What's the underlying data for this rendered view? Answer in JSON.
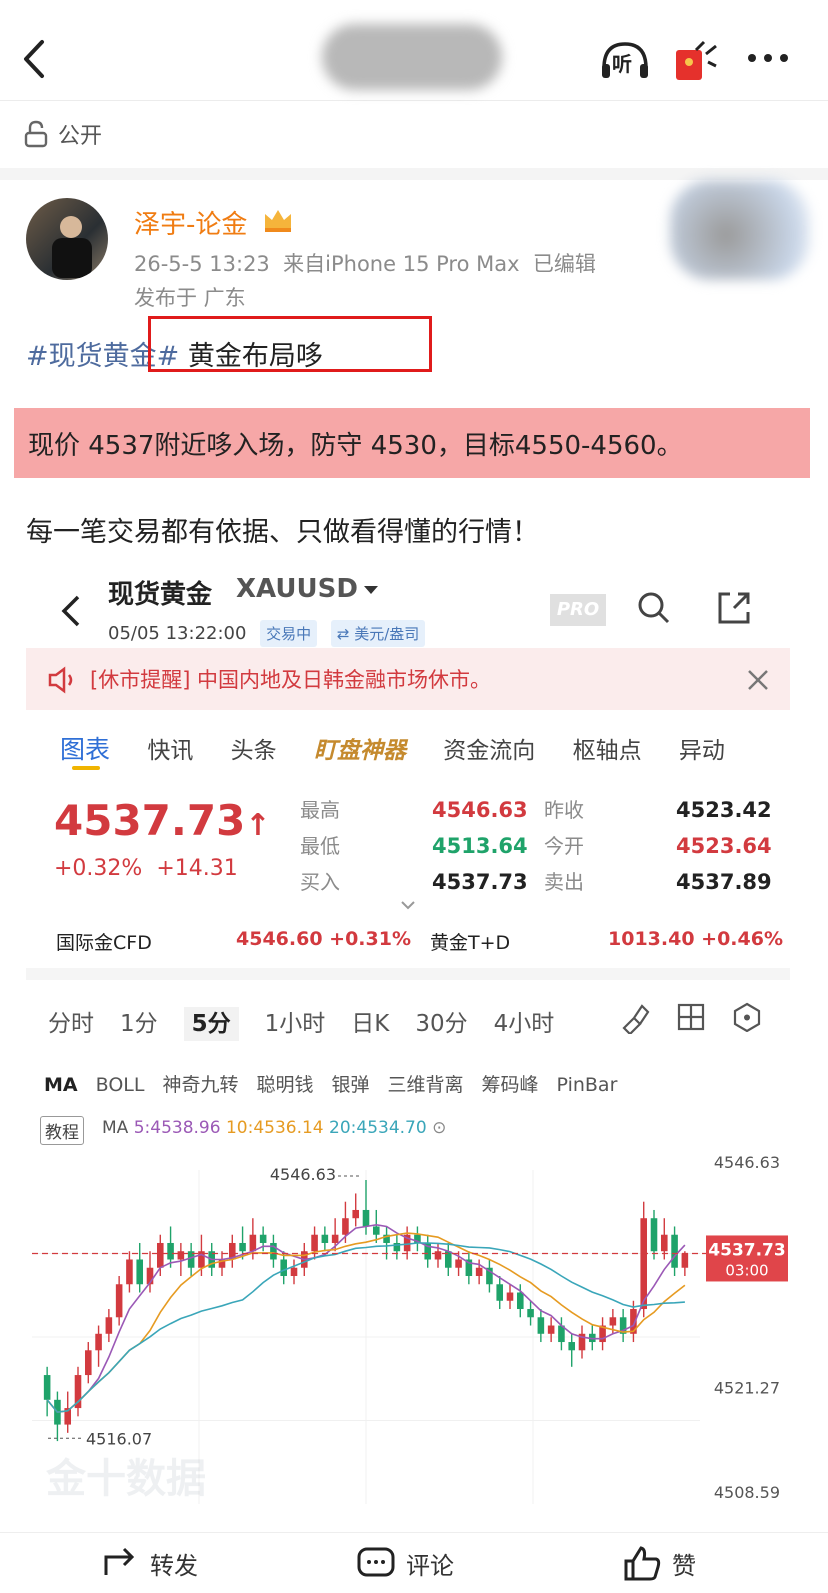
{
  "nav": {
    "back_icon": "chevron-left-icon",
    "listen_label": "听",
    "more_icon": "more-icon"
  },
  "visibility": {
    "label": "公开",
    "icon": "lock-open-icon"
  },
  "post": {
    "author": "泽宇-论金",
    "timestamp": "26-5-5 13:23",
    "source": "来自iPhone 15 Pro Max",
    "edited": "已编辑",
    "location": "发布于 广东",
    "hashtag": "#现货黄金#",
    "headline": "黄金布局哆",
    "highlight": "现价 4537附近哆入场，防守 4530，目标4550-4560。",
    "body": "每一笔交易都有依据、只做看得懂的行情！"
  },
  "quote": {
    "name": "现货黄金",
    "code": "XAUUSD",
    "time": "05/05 13:22:00",
    "status": "交易中",
    "unit": "⇄ 美元/盎司",
    "pro": "PRO",
    "notice": "[休市提醒] 中国内地及日韩金融市场休市。",
    "tabs": [
      "图表",
      "快讯",
      "头条",
      "盯盘神器",
      "资金流向",
      "枢轴点",
      "异动"
    ],
    "price": "4537.73",
    "arrow": "↑",
    "change_pct": "+0.32%",
    "change_abs": "+14.31",
    "high_label": "最高",
    "high": "4546.63",
    "low_label": "最低",
    "low": "4513.64",
    "buy_label": "买入",
    "buy": "4537.73",
    "prev_label": "昨收",
    "prev": "4523.42",
    "open_label": "今开",
    "open": "4523.64",
    "sell_label": "卖出",
    "sell": "4537.89",
    "cfd_label": "国际金CFD",
    "cfd": "4546.60  +0.31%",
    "td_label": "黄金T+D",
    "td": "1013.40  +0.46%",
    "periods": [
      "分时",
      "1分",
      "5分",
      "1小时",
      "日K",
      "30分",
      "4小时"
    ],
    "indicators": [
      "MA",
      "BOLL",
      "神奇九转",
      "聪明钱",
      "银弹",
      "三维背离",
      "筹码峰",
      "PinBar"
    ],
    "tutorial": "教程",
    "ma_label": "MA",
    "ma5": "5:4538.96",
    "ma10": "10:4536.14",
    "ma20": "20:4534.70",
    "watermark": "金十数据",
    "current_time": "03:00"
  },
  "chart_data": {
    "type": "candlestick",
    "ylim": [
      4508.59,
      4546.63
    ],
    "y_ticks": [
      4546.63,
      4521.27,
      4508.59
    ],
    "current_price": 4537.73,
    "high_marker": 4546.63,
    "low_marker": 4516.07,
    "candles": [
      [
        4523,
        4520,
        4524,
        4518
      ],
      [
        4520,
        4517,
        4521,
        4515
      ],
      [
        4517,
        4519,
        4521,
        4516
      ],
      [
        4519,
        4523,
        4524,
        4518
      ],
      [
        4523,
        4526,
        4527,
        4522
      ],
      [
        4526,
        4528,
        4529,
        4524
      ],
      [
        4528,
        4530,
        4531,
        4527
      ],
      [
        4530,
        4534,
        4535,
        4529
      ],
      [
        4534,
        4537,
        4538,
        4533
      ],
      [
        4537,
        4534,
        4539,
        4533
      ],
      [
        4534,
        4536,
        4538,
        4533
      ],
      [
        4536,
        4539,
        4540,
        4535
      ],
      [
        4539,
        4537,
        4541,
        4536
      ],
      [
        4537,
        4538,
        4539,
        4535
      ],
      [
        4538,
        4536,
        4539,
        4535
      ],
      [
        4536,
        4538,
        4540,
        4535
      ],
      [
        4538,
        4536,
        4539,
        4535
      ],
      [
        4536,
        4537,
        4538,
        4535
      ],
      [
        4537,
        4539,
        4540,
        4536
      ],
      [
        4539,
        4538,
        4541,
        4537
      ],
      [
        4538,
        4540,
        4542,
        4537
      ],
      [
        4540,
        4539,
        4541,
        4538
      ],
      [
        4539,
        4537,
        4540,
        4536
      ],
      [
        4537,
        4535,
        4538,
        4534
      ],
      [
        4535,
        4536,
        4537,
        4534
      ],
      [
        4536,
        4538,
        4539,
        4535
      ],
      [
        4538,
        4540,
        4541,
        4537
      ],
      [
        4540,
        4539,
        4541,
        4538
      ],
      [
        4539,
        4540,
        4542,
        4538
      ],
      [
        4540,
        4542,
        4544,
        4539
      ],
      [
        4542,
        4543,
        4545,
        4541
      ],
      [
        4543,
        4541,
        4546.63,
        4540
      ],
      [
        4541,
        4540,
        4543,
        4539
      ],
      [
        4540,
        4539,
        4541,
        4537
      ],
      [
        4539,
        4538,
        4540,
        4537
      ],
      [
        4538,
        4540,
        4541,
        4537
      ],
      [
        4540,
        4539,
        4541,
        4538
      ],
      [
        4539,
        4537,
        4540,
        4536
      ],
      [
        4537,
        4538,
        4539,
        4536
      ],
      [
        4538,
        4536,
        4539,
        4535
      ],
      [
        4536,
        4537,
        4538,
        4535
      ],
      [
        4537,
        4535,
        4538,
        4534
      ],
      [
        4535,
        4536,
        4537,
        4534
      ],
      [
        4536,
        4534,
        4537,
        4533
      ],
      [
        4534,
        4532,
        4535,
        4531
      ],
      [
        4532,
        4533,
        4534,
        4531
      ],
      [
        4533,
        4531,
        4534,
        4530
      ],
      [
        4531,
        4530,
        4532,
        4529
      ],
      [
        4530,
        4528,
        4531,
        4527
      ],
      [
        4528,
        4529,
        4530,
        4527
      ],
      [
        4529,
        4527,
        4530,
        4526
      ],
      [
        4527,
        4526,
        4528,
        4524
      ],
      [
        4526,
        4528,
        4529,
        4525
      ],
      [
        4528,
        4527,
        4529,
        4526
      ],
      [
        4527,
        4529,
        4530,
        4526
      ],
      [
        4529,
        4530,
        4531,
        4528
      ],
      [
        4530,
        4528,
        4531,
        4527
      ],
      [
        4528,
        4531,
        4532,
        4527
      ],
      [
        4531,
        4542,
        4544,
        4530
      ],
      [
        4542,
        4538,
        4543,
        4537
      ],
      [
        4538,
        4540,
        4542,
        4537
      ],
      [
        4540,
        4536,
        4541,
        4535
      ],
      [
        4536,
        4537.73,
        4538,
        4535
      ]
    ]
  },
  "bottom": {
    "repost": "转发",
    "comment": "评论",
    "like": "赞"
  }
}
